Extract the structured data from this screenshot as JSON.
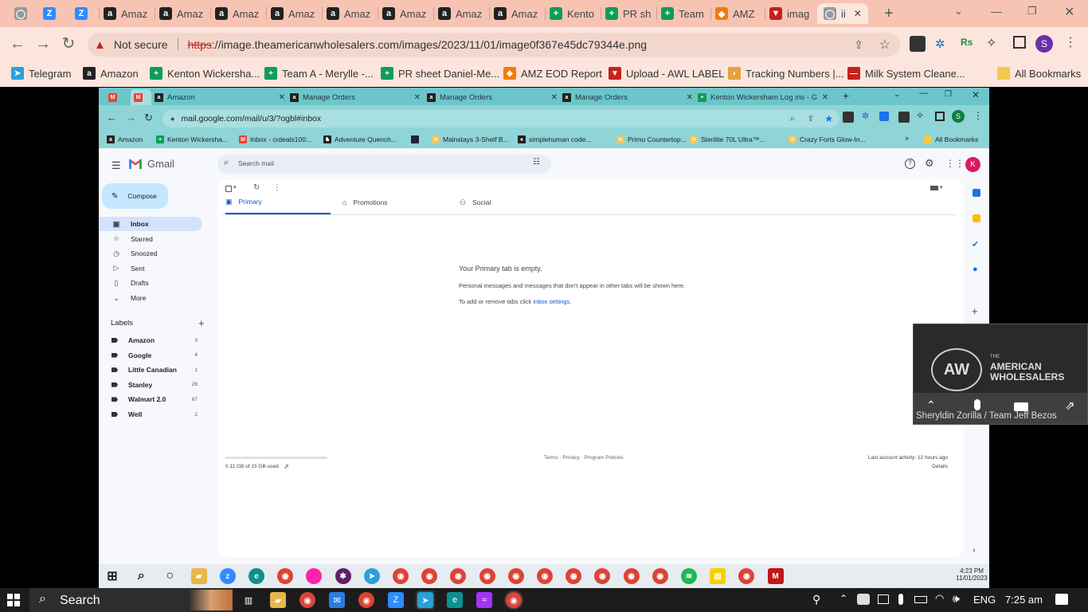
{
  "outer_browser": {
    "tabs": [
      {
        "label": "",
        "icon": "globe-icon"
      },
      {
        "label": "",
        "icon": "zoom-icon"
      },
      {
        "label": "",
        "icon": "zoom-icon"
      },
      {
        "label": "Amaz",
        "icon": "amazon-icon"
      },
      {
        "label": "Amaz",
        "icon": "amazon-icon"
      },
      {
        "label": "Amaz",
        "icon": "amazon-icon"
      },
      {
        "label": "Amaz",
        "icon": "amazon-icon"
      },
      {
        "label": "Amaz",
        "icon": "amazon-icon"
      },
      {
        "label": "Amaz",
        "icon": "amazon-icon"
      },
      {
        "label": "Amaz",
        "icon": "amazon-icon"
      },
      {
        "label": "Amaz",
        "icon": "amazon-icon"
      },
      {
        "label": "Kento",
        "icon": "sheets-icon"
      },
      {
        "label": "PR sh",
        "icon": "sheets-icon"
      },
      {
        "label": "Team",
        "icon": "sheets-icon"
      },
      {
        "label": "AMZ",
        "icon": "script-icon"
      },
      {
        "label": "imag",
        "icon": "shield-icon"
      },
      {
        "label": "ii",
        "icon": "globe-icon"
      }
    ],
    "security_label": "Not secure",
    "url_scheme": "https",
    "url_rest": "://image.theamericanwholesalers.com/images/2023/11/01/image0f367e45dc79344e.png",
    "bookmarks": [
      "Telegram",
      "Amazon",
      "Kenton Wickersha...",
      "Team A - Merylle -...",
      "PR sheet Daniel-Me...",
      "AMZ EOD Report",
      "Upload - AWL LABEL",
      "Tracking Numbers |...",
      "Milk System Cleane..."
    ],
    "all_bookmarks": "All Bookmarks",
    "profile_initial": "S"
  },
  "inner_browser": {
    "tabs": [
      "",
      "",
      "Amazon",
      "Manage Orders",
      "Manage Orders",
      "Manage Orders",
      "Kenton Wickersham Log ins - G"
    ],
    "url": "mail.google.com/mail/u/3/?ogbl#inbox",
    "bookmarks": [
      "Amazon",
      "Kenton Wickersha...",
      "Inbox - crdeals100...",
      "Adventure Quench...",
      "Mainstays 3-Shelf B...",
      "simplehuman code...",
      "Primo Countertop...",
      "Sterilite 70L Ultra™...",
      "Crazy Forts Glow-In..."
    ],
    "all_bookmarks": "All Bookmarks",
    "profile_initial": "S"
  },
  "gmail": {
    "brand": "Gmail",
    "search_placeholder": "Search mail",
    "account_initial": "K",
    "compose": "Compose",
    "nav": [
      {
        "label": "Inbox",
        "icon": "inbox-icon"
      },
      {
        "label": "Starred",
        "icon": "star-icon"
      },
      {
        "label": "Snoozed",
        "icon": "clock-icon"
      },
      {
        "label": "Sent",
        "icon": "send-icon"
      },
      {
        "label": "Drafts",
        "icon": "draft-icon"
      },
      {
        "label": "More",
        "icon": "chevron-down-icon"
      }
    ],
    "labels_heading": "Labels",
    "labels": [
      {
        "name": "Amazon",
        "count": "3"
      },
      {
        "name": "Google",
        "count": "4"
      },
      {
        "name": "Little Canadian",
        "count": "1"
      },
      {
        "name": "Stanley",
        "count": "26"
      },
      {
        "name": "Walmart 2.0",
        "count": "67"
      },
      {
        "name": "Well",
        "count": "2"
      }
    ],
    "tabs": [
      "Primary",
      "Promotions",
      "Social"
    ],
    "empty_title": "Your Primary tab is empty.",
    "empty_line": "Personal messages and messages that don't appear in other tabs will be shown here.",
    "empty_add_prefix": "To add or remove tabs click ",
    "empty_add_link": "inbox settings",
    "empty_add_suffix": ".",
    "storage": "0.11 GB of 15 GB used",
    "footer_links": "Terms · Privacy · Program Policies",
    "last_activity": "Last account activity: 12 hours ago",
    "details": "Details"
  },
  "inner_clock": {
    "time": "4:23 PM",
    "date": "11/01/2023"
  },
  "zoom_overlay": {
    "logo_line1": "THE",
    "logo_line2": "AMERICAN",
    "logo_line3": "WHOLESALERS",
    "participant": "Sheryldin Zorilla / Team Jeff Bezos"
  },
  "taskbar": {
    "search": "Search",
    "language": "ENG",
    "time": "7:25 am"
  }
}
